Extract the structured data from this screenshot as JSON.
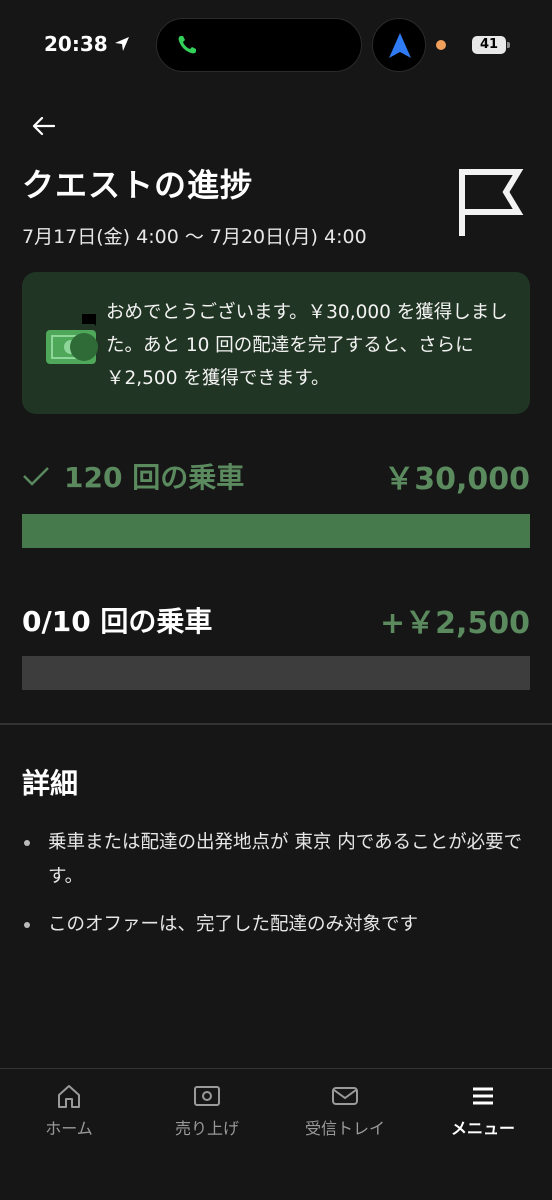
{
  "status_bar": {
    "time": "20:38",
    "battery": "41"
  },
  "header": {
    "title": "クエストの進捗",
    "dates": "7月17日(金) 4:00 〜 7月20日(月) 4:00"
  },
  "banner": {
    "message": "おめでとうございます。￥30,000 を獲得しました。あと 10 回の配達を完了すると、さらに ￥2,500 を獲得できます。"
  },
  "progress": [
    {
      "label": "120 回の乗車",
      "amount": "￥30,000",
      "completed": true,
      "fill_fraction": 1.0
    },
    {
      "label": "0/10 回の乗車",
      "amount": "+￥2,500",
      "completed": false,
      "fill_fraction": 0.0
    }
  ],
  "details": {
    "heading": "詳細",
    "items": [
      "乗車または配達の出発地点が 東京 内であることが必要です。",
      "このオファーは、完了した配達のみ対象です"
    ]
  },
  "tabs": [
    {
      "label": "ホーム",
      "icon": "home-icon",
      "active": false
    },
    {
      "label": "売り上げ",
      "icon": "earnings-icon",
      "active": false
    },
    {
      "label": "受信トレイ",
      "icon": "inbox-icon",
      "active": false
    },
    {
      "label": "メニュー",
      "icon": "menu-icon",
      "active": true
    }
  ],
  "colors": {
    "accent_green": "#467a4c",
    "banner_bg": "#213524",
    "background": "#161616"
  }
}
